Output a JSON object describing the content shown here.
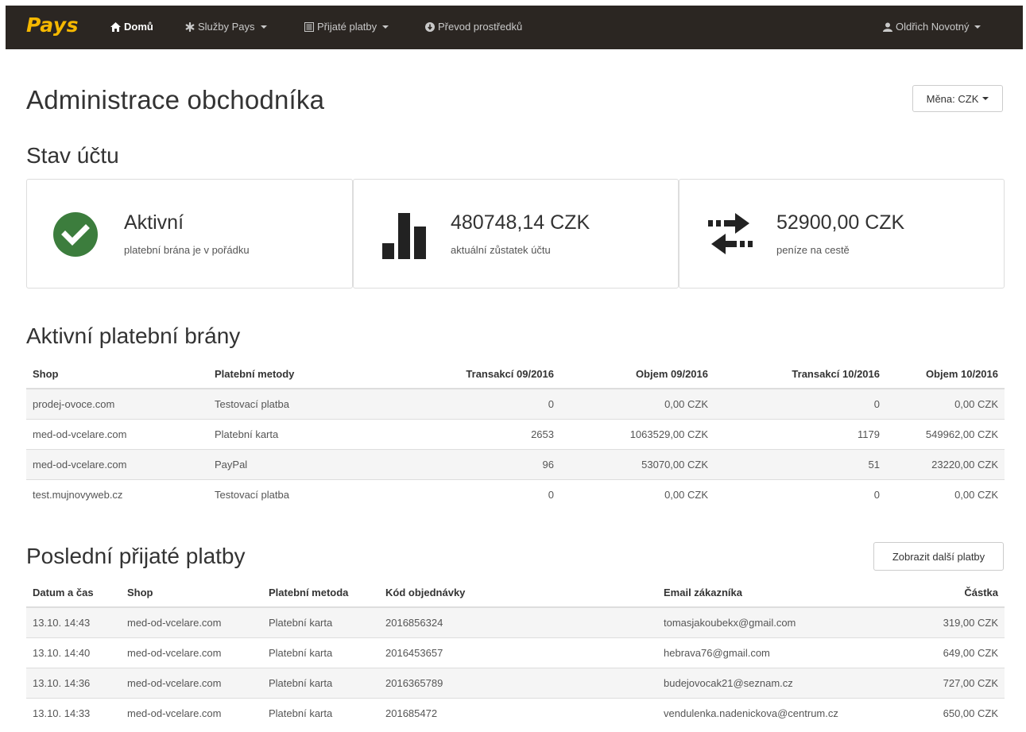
{
  "navbar": {
    "brand": "Pays",
    "items": [
      {
        "label": "Domů"
      },
      {
        "label": "Služby Pays"
      },
      {
        "label": "Přijaté platby"
      },
      {
        "label": "Převod prostředků"
      }
    ],
    "user": "Oldřich Novotný"
  },
  "page_title": "Administrace obchodníka",
  "currency_button": "Měna: CZK",
  "account_status": {
    "title": "Stav účtu",
    "cards": [
      {
        "value": "Aktivní",
        "desc": "platební brána je v pořádku",
        "icon": "check-circle-icon"
      },
      {
        "value": "480748,14 CZK",
        "desc": "aktuální zůstatek účtu",
        "icon": "bar-chart-icon"
      },
      {
        "value": "52900,00 CZK",
        "desc": "peníze na cestě",
        "icon": "transfer-arrows-icon"
      }
    ]
  },
  "gateways": {
    "title": "Aktivní platební brány",
    "headers": [
      "Shop",
      "Platební metody",
      "Transakcí 09/2016",
      "Objem 09/2016",
      "Transakcí 10/2016",
      "Objem 10/2016"
    ],
    "rows": [
      [
        "prodej-ovoce.com",
        "Testovací platba",
        "0",
        "0,00 CZK",
        "0",
        "0,00 CZK"
      ],
      [
        "med-od-vcelare.com",
        "Platební karta",
        "2653",
        "1063529,00 CZK",
        "1179",
        "549962,00 CZK"
      ],
      [
        "med-od-vcelare.com",
        "PayPal",
        "96",
        "53070,00 CZK",
        "51",
        "23220,00 CZK"
      ],
      [
        "test.mujnovyweb.cz",
        "Testovací platba",
        "0",
        "0,00 CZK",
        "0",
        "0,00 CZK"
      ]
    ]
  },
  "payments": {
    "title": "Poslední přijaté platby",
    "more_button": "Zobrazit další platby",
    "headers": [
      "Datum a čas",
      "Shop",
      "Platební metoda",
      "Kód objednávky",
      "Email zákazníka",
      "Částka"
    ],
    "rows": [
      [
        "13.10. 14:43",
        "med-od-vcelare.com",
        "Platební karta",
        "2016856324",
        "tomasjakoubekx@gmail.com",
        "319,00 CZK"
      ],
      [
        "13.10. 14:40",
        "med-od-vcelare.com",
        "Platební karta",
        "2016453657",
        "hebrava76@gmail.com",
        "649,00 CZK"
      ],
      [
        "13.10. 14:36",
        "med-od-vcelare.com",
        "Platební karta",
        "2016365789",
        "budejovocak21@seznam.cz",
        "727,00 CZK"
      ],
      [
        "13.10. 14:33",
        "med-od-vcelare.com",
        "Platební karta",
        "201685472",
        "vendulenka.nadenickova@centrum.cz",
        "650,00 CZK"
      ]
    ]
  },
  "colors": {
    "navbar_bg": "#2b2622",
    "brand": "#f5b800",
    "success_green": "#3c7d3d"
  }
}
